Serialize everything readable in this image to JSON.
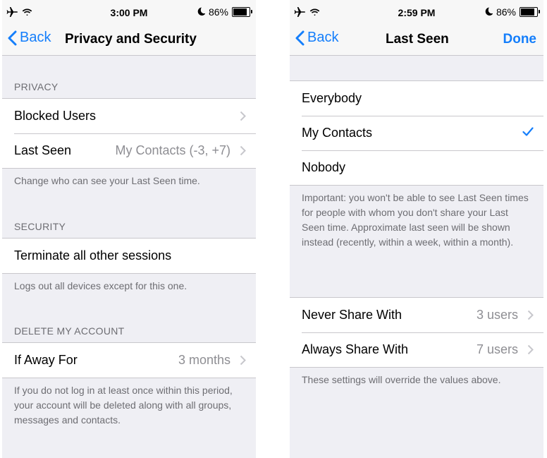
{
  "left_screen": {
    "status": {
      "time": "3:00 PM",
      "battery": "86%",
      "battery_level": 0.86
    },
    "nav": {
      "back_label": "Back",
      "title": "Privacy and Security"
    },
    "privacy_header": "PRIVACY",
    "blocked_users_label": "Blocked Users",
    "last_seen_label": "Last Seen",
    "last_seen_value": "My Contacts (-3, +7)",
    "privacy_footer": "Change who can see your Last Seen time.",
    "security_header": "SECURITY",
    "terminate_label": "Terminate all other sessions",
    "security_footer": "Logs out all devices except for this one.",
    "delete_header": "DELETE MY ACCOUNT",
    "away_label": "If Away For",
    "away_value": "3 months",
    "delete_footer": "If you do not log in at least once within this period, your account will be deleted along with all groups, messages and contacts."
  },
  "right_screen": {
    "status": {
      "time": "2:59 PM",
      "battery": "86%",
      "battery_level": 0.86
    },
    "nav": {
      "back_label": "Back",
      "title": "Last Seen",
      "done_label": "Done"
    },
    "options": [
      "Everybody",
      "My Contacts",
      "Nobody"
    ],
    "selected_option": "My Contacts",
    "options_footer": "Important: you won't be able to see Last Seen times for people with whom you don't share your Last Seen time. Approximate last seen will be shown instead (recently, within a week, within a month).",
    "never_share_label": "Never Share With",
    "never_share_value": "3 users",
    "always_share_label": "Always Share With",
    "always_share_value": "7 users",
    "exceptions_footer": "These settings will override the values above."
  },
  "colors": {
    "accent": "#147efb",
    "background": "#efeff4",
    "secondary_text": "#8e8e93"
  },
  "icons": [
    "airplane-icon",
    "wifi-icon",
    "moon-icon",
    "battery-icon",
    "back-chevron-icon",
    "chevron-right-icon",
    "checkmark-icon"
  ]
}
